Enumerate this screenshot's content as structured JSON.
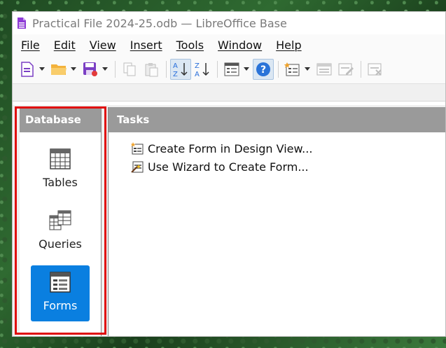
{
  "window": {
    "title": "Practical File 2024-25.odb — LibreOffice Base"
  },
  "menu": [
    "File",
    "Edit",
    "View",
    "Insert",
    "Tools",
    "Window",
    "Help"
  ],
  "toolbar": {
    "icons": [
      "new-document-icon",
      "open-folder-icon",
      "save-icon",
      "copy-icon",
      "paste-icon",
      "sort-ascending-icon",
      "sort-descending-icon",
      "form-icon",
      "help-icon",
      "report-icon",
      "open-database-object-icon",
      "edit-icon",
      "delete-icon"
    ]
  },
  "database_panel": {
    "header": "Database",
    "items": [
      {
        "label": "Tables",
        "icon": "table-icon",
        "selected": false
      },
      {
        "label": "Queries",
        "icon": "query-icon",
        "selected": false
      },
      {
        "label": "Forms",
        "icon": "form-icon",
        "selected": true
      }
    ]
  },
  "tasks_panel": {
    "header": "Tasks",
    "items": [
      {
        "label": "Create Form in Design View...",
        "icon": "design-view-icon"
      },
      {
        "label": "Use Wizard to Create Form...",
        "icon": "wizard-icon"
      }
    ]
  },
  "colors": {
    "highlight_box": "#e00b0b",
    "selected_item": "#0a7fe0",
    "panel_header": "#9a9a9a"
  }
}
